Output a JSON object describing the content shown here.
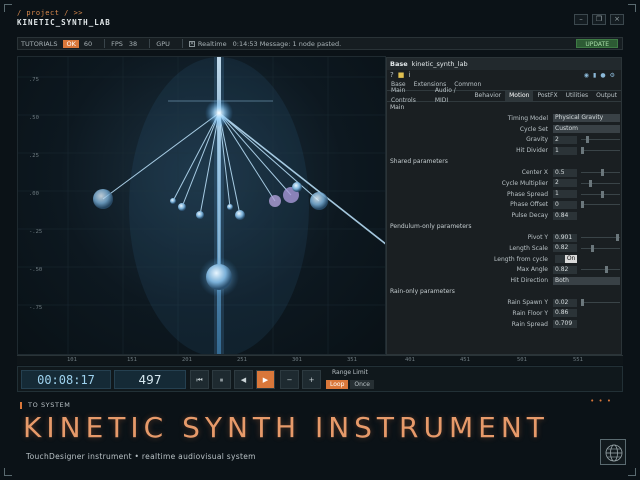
{
  "header": {
    "breadcrumb": "/ project / >>",
    "project": "KINETIC_SYNTH_LAB",
    "window_buttons": [
      "–",
      "❐",
      "×"
    ]
  },
  "toolbar": {
    "tutorials": "TUTORIALS",
    "ok_badge": "OK",
    "value_60": "60",
    "fps_label": "FPS",
    "fps_value": "38",
    "gpu": "GPU",
    "realtime_label": "Realtime",
    "message": "0:14:53 Message: 1 node pasted.",
    "update": "UPDATE"
  },
  "viewport": {
    "y_ticks": [
      ".75",
      ".50",
      ".25",
      ".00",
      "-.25",
      "-.50",
      "-.75"
    ]
  },
  "panel": {
    "title_prefix": "Base",
    "title_name": "kinetic_synth_lab",
    "subtabs": [
      "Base",
      "Extensions",
      "Common"
    ],
    "tabs": [
      "Main Controls",
      "Audio / MIDI",
      "Behavior",
      "Motion",
      "PostFX",
      "Utilities",
      "Output"
    ],
    "active_tab": "Motion",
    "sections": {
      "main": "Main",
      "shared": "Shared parameters",
      "pendulum": "Pendulum-only parameters",
      "rain": "Rain-only parameters"
    },
    "main_params": [
      {
        "label": "Timing Model",
        "value": "Physical Gravity"
      },
      {
        "label": "Cycle Set",
        "value": "Custom"
      },
      {
        "label": "Gravity",
        "value": "2"
      },
      {
        "label": "Hit Divider",
        "value": "1"
      }
    ],
    "shared_params": [
      {
        "label": "Center X",
        "value": "0.5"
      },
      {
        "label": "Cycle Multiplier",
        "value": "2"
      },
      {
        "label": "Phase Spread",
        "value": "1"
      },
      {
        "label": "Phase Offset",
        "value": "0"
      },
      {
        "label": "Pulse Decay",
        "value": "0.84"
      }
    ],
    "pendulum_params": [
      {
        "label": "Pivot Y",
        "value": "0.901"
      },
      {
        "label": "Length Scale",
        "value": "0.82"
      },
      {
        "label": "Length from cycle",
        "value": "On"
      },
      {
        "label": "Max Angle",
        "value": "0.82"
      },
      {
        "label": "Hit Direction",
        "value": "Both"
      }
    ],
    "rain_params": [
      {
        "label": "Rain Spawn Y",
        "value": "0.02"
      },
      {
        "label": "Rain Floor Y",
        "value": "0.86"
      },
      {
        "label": "Rain Spread",
        "value": "0.709"
      }
    ]
  },
  "ruler": {
    "ticks": [
      "101",
      "151",
      "201",
      "251",
      "301",
      "351",
      "401",
      "451",
      "501",
      "551"
    ]
  },
  "transport": {
    "timecode": "00:08:17",
    "frame": "497",
    "buttons": [
      "⏮",
      "⏸",
      "◀",
      "▶",
      "−",
      "+"
    ],
    "range_limit": "Range Limit",
    "loop": "Loop",
    "once": "Once"
  },
  "footer": {
    "to_system": "TO SYSTEM",
    "dots": "• • •",
    "title": "KINETIC SYNTH INSTRUMENT",
    "subtitle": "TouchDesigner instrument  •  realtime audiovisual system"
  }
}
